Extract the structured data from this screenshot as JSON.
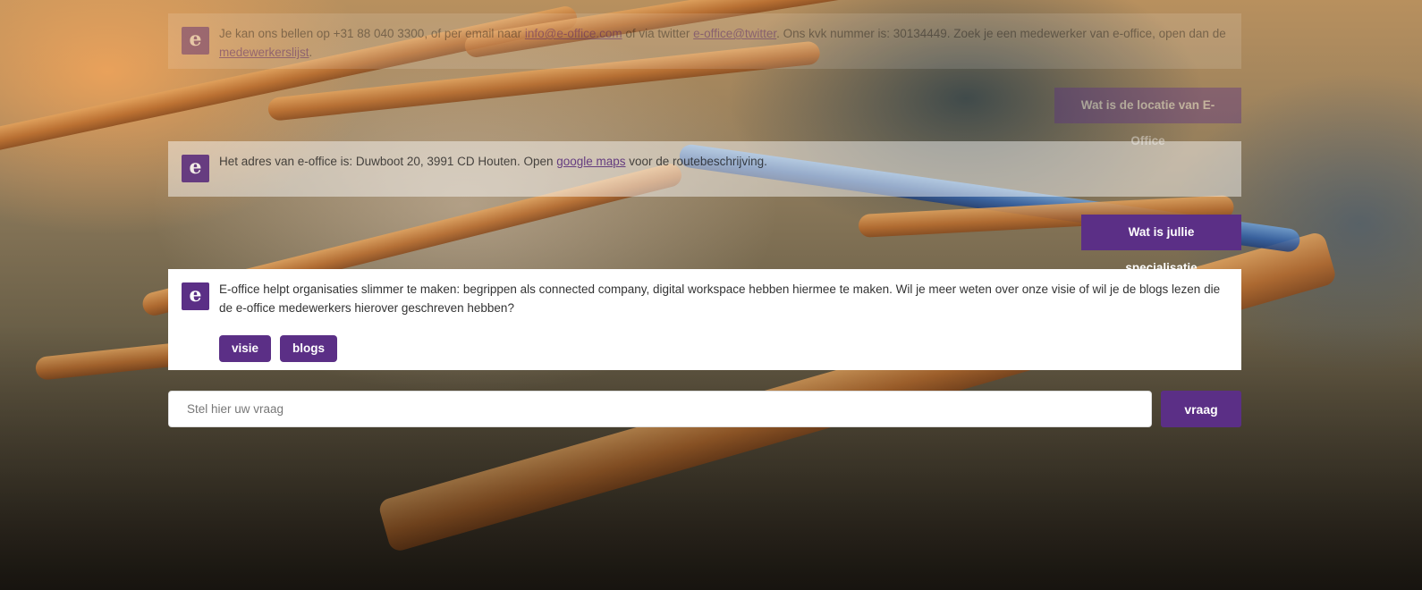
{
  "conversation": {
    "messages": [
      {
        "role": "bot",
        "avatar_letter": "e",
        "text_before": "Je kan ons bellen op +31 88 040 3300, of per email naar ",
        "link1": "info@e-office.com",
        "text_mid1": " of via twitter ",
        "link2": "e-office@twitter",
        "text_mid2": ". Ons kvk nummer is: 30134449. Zoek je een medewerker van e-office, open dan de ",
        "link3": "medewerkerslijst",
        "text_after": "."
      },
      {
        "role": "user",
        "text": "Wat is de locatie van E-Office"
      },
      {
        "role": "bot",
        "avatar_letter": "e",
        "text_before": "Het adres van e-office is: Duwboot 20, 3991 CD Houten. Open ",
        "link1": "google maps",
        "text_after": " voor de routebeschrijving."
      },
      {
        "role": "user",
        "text": "Wat is jullie specialisatie"
      },
      {
        "role": "bot",
        "avatar_letter": "e",
        "text": "E-office helpt organisaties slimmer te maken: begrippen als connected company, digital workspace hebben hiermee te maken. Wil je meer weten over onze visie of wil je de blogs lezen die de e-office medewerkers hierover geschreven hebben?",
        "options": [
          "visie",
          "blogs"
        ]
      }
    ]
  },
  "input": {
    "placeholder": "Stel hier uw vraag",
    "value": "",
    "submit_label": "vraag"
  },
  "colors": {
    "accent": "#5b2f86",
    "bubble_bg": "#ffffff",
    "text": "#333333"
  }
}
